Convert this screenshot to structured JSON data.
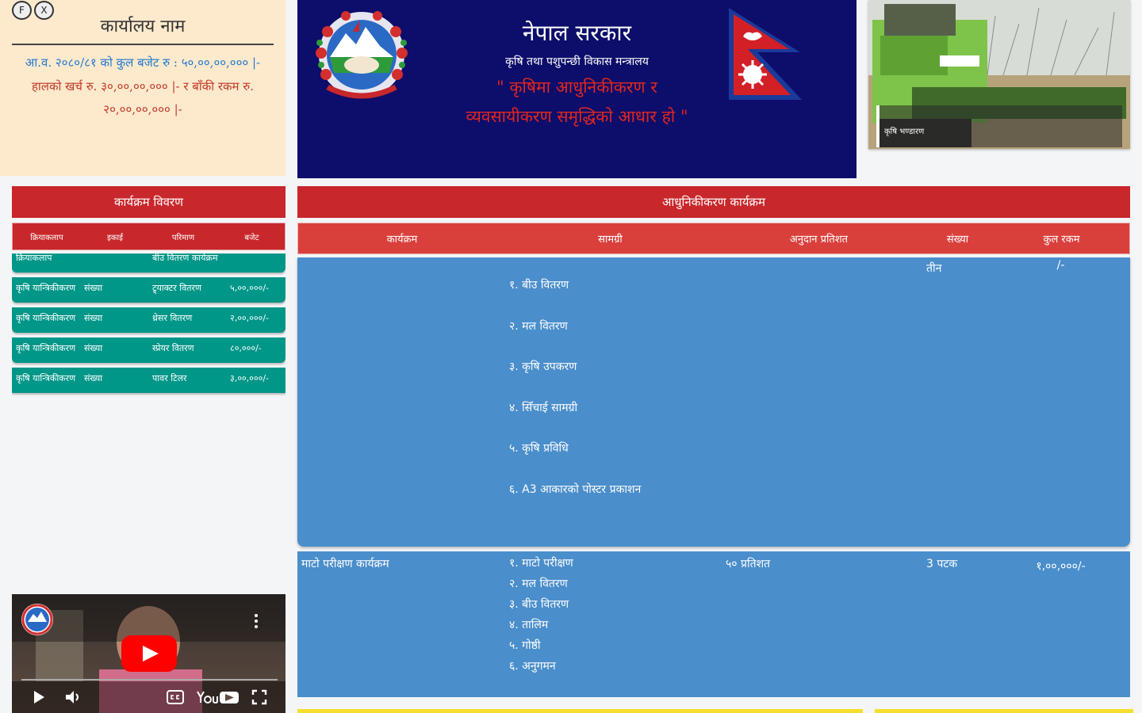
{
  "info_panel": {
    "btn_f": "F",
    "btn_x": "X",
    "office_title": "कार्यालय नाम",
    "budget_line": "आ.व. २०८०/८१ को कुल बजेट रु : ५०,००,००,००० |-",
    "spent_line": "हालको खर्च रु. ३०,००,००,००० |- र बाँकी रकम रु. २०,००,००,००० |-"
  },
  "banner": {
    "title": "नेपाल सरकार",
    "subtitle": "कृषि तथा पशुपन्छी विकास मन्त्रालय",
    "slogan": "\" कृषिमा आधुनिकीकरण र व्यवसायीकरण समृद्धिको आधार हो \""
  },
  "photo": {
    "caption": "कृषि भण्डारण"
  },
  "left_table": {
    "title": "कार्यक्रम विवरण",
    "columns": [
      "क्रियाकलाप",
      "इकाई",
      "परिमाण",
      "बजेट"
    ],
    "rows": [
      {
        "c1": "क्रियाकलाप",
        "c2": "",
        "c3": "बीउ वितरण कार्यक्रम",
        "c4": ""
      },
      {
        "c1": "कृषि यान्त्रिकीकरण",
        "c2": "संख्या",
        "c3": "ट्र्याक्टर वितरण",
        "c4": "५,००,०००/-"
      },
      {
        "c1": "कृषि यान्त्रिकीकरण",
        "c2": "संख्या",
        "c3": "थ्रेसर वितरण",
        "c4": "२,००,०००/-"
      },
      {
        "c1": "कृषि यान्त्रिकीकरण",
        "c2": "संख्या",
        "c3": "स्प्रेयर वितरण",
        "c4": "८०,०००/-"
      },
      {
        "c1": "कृषि यान्त्रिकीकरण",
        "c2": "संख्या",
        "c3": "पावर टिलर",
        "c4": "३,००,०००/-"
      }
    ]
  },
  "main_table": {
    "title": "आधुनिकीकरण कार्यक्रम",
    "columns": [
      "कार्यक्रम",
      "सामग्री",
      "अनुदान प्रतिशत",
      "संख्या",
      "कुल रकम"
    ],
    "row1": {
      "c1": "",
      "items": [
        "१. बीउ वितरण",
        "२. मल वितरण",
        "३. कृषि उपकरण",
        "४. सिँचाई सामग्री",
        "५. कृषि प्रविधि",
        "६. A3 आकारको पोस्टर प्रकाशन"
      ],
      "c3": "",
      "c4": "तीन",
      "c5": "/-"
    },
    "row2": {
      "c1": "माटो परीक्षण कार्यक्रम",
      "items": [
        "१. माटो परीक्षण",
        "२. मल वितरण",
        "३. बीउ वितरण",
        "४. तालिम",
        "५. गोष्ठी",
        "६. अनुगमन"
      ],
      "c3": "५० प्रतिशत",
      "c4": "3 पटक",
      "c5": "१,००,०००/-"
    }
  }
}
